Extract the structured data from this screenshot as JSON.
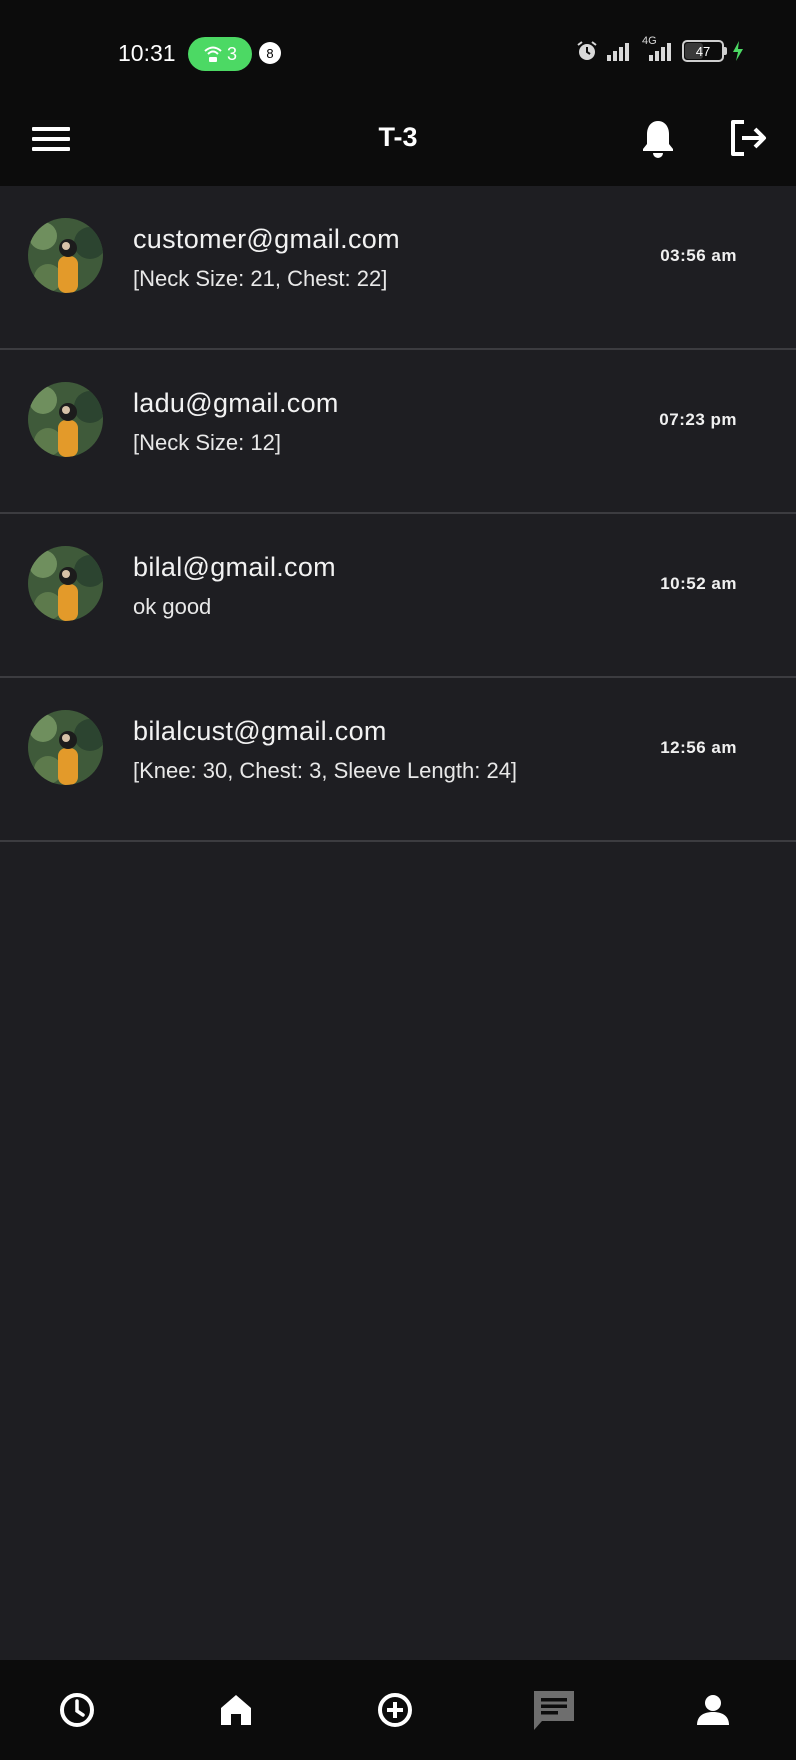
{
  "status_bar": {
    "time": "10:31",
    "hotspot_count": "3",
    "notification_count": "8",
    "network_label": "4G",
    "battery_percent": "47",
    "battery_level": 0.47
  },
  "app_bar": {
    "title": "T-3",
    "menu_icon": "menu-icon",
    "notification_icon": "bell-icon",
    "logout_icon": "logout-icon"
  },
  "chats": [
    {
      "email": "customer@gmail.com",
      "preview": "[Neck Size: 21, Chest: 22]",
      "time": "03:56 am"
    },
    {
      "email": "ladu@gmail.com",
      "preview": "[Neck Size: 12]",
      "time": "07:23 pm"
    },
    {
      "email": "bilal@gmail.com",
      "preview": "ok good",
      "time": "10:52 am"
    },
    {
      "email": "bilalcust@gmail.com",
      "preview": "[Knee: 30, Chest: 3, Sleeve Length: 24]",
      "time": "12:56 am"
    }
  ],
  "bottom_nav": {
    "items": [
      {
        "icon": "history-clock-icon",
        "active": false
      },
      {
        "icon": "home-icon",
        "active": false
      },
      {
        "icon": "add-circle-icon",
        "active": false
      },
      {
        "icon": "chat-icon",
        "active": true
      },
      {
        "icon": "profile-icon",
        "active": false
      }
    ],
    "active_color": "#6e6e6e",
    "inactive_color": "#ffffff"
  }
}
